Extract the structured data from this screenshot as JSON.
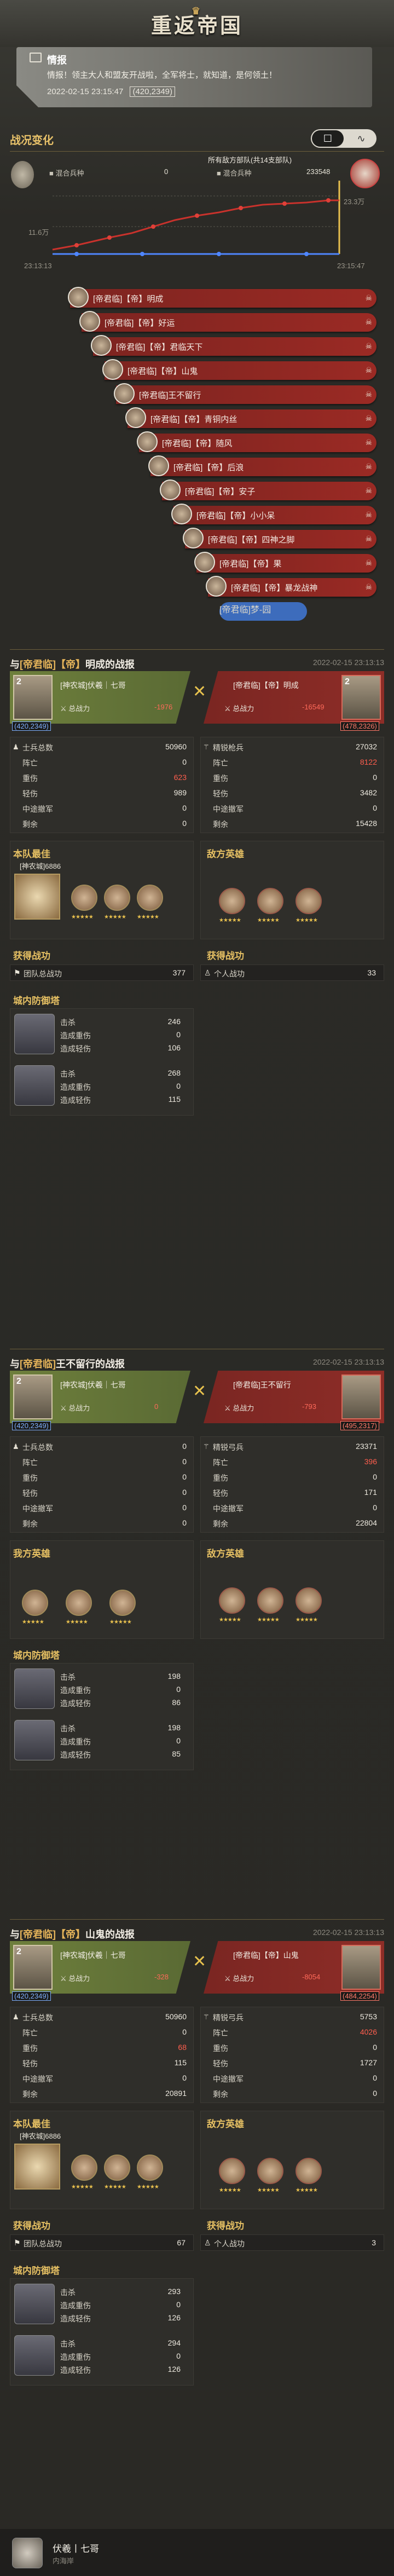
{
  "header": {
    "logo_text": "重返帝国"
  },
  "intel": {
    "title": "情报",
    "body": "情报！领主大人和盟友开战啦，全军将士，就知道，是何领土！",
    "date": "2022-02-15 23:15:47",
    "coords": "(420,2349)"
  },
  "trend": {
    "title": "战况变化",
    "toggle_on": "☐",
    "toggle_off": "∿",
    "left_label": "混合兵种",
    "left_value": "0",
    "right_caption": "所有敌方部队(共14支部队)",
    "right_label": "混合兵种",
    "right_value": "233548",
    "y_left": "11.6万",
    "y_right": "23.3万",
    "x_start": "23:13:13",
    "x_end": "23:15:47",
    "vs_right_icon": "king-icon"
  },
  "feed": [
    {
      "text": "[帝君临]【帝】明成"
    },
    {
      "text": "[帝君临]【帝】好运"
    },
    {
      "text": "[帝君临]【帝】君临天下"
    },
    {
      "text": "[帝君临]【帝】山鬼"
    },
    {
      "text": "[帝君临]王不留行"
    },
    {
      "text": "[帝君临]【帝】青铜内丝"
    },
    {
      "text": "[帝君临]【帝】随风"
    },
    {
      "text": "[帝君临]【帝】后浪"
    },
    {
      "text": "[帝君临]【帝】安子"
    },
    {
      "text": "[帝君临]【帝】小小呆"
    },
    {
      "text": "[帝君临]【帝】四神之脚"
    },
    {
      "text": "[帝君临]【帝】果"
    },
    {
      "text": "[帝君临]【帝】暴龙战神"
    },
    {
      "text": "[帝君临]梦-园"
    }
  ],
  "reports": [
    {
      "title_prefix": "与",
      "title_alli": "[帝君临]【帝】",
      "title_name": "明成",
      "title_suffix": "的战报",
      "date": "2022-02-15 23:13:13",
      "left": {
        "lv": "2",
        "name": "[神农城]伏羲｜七哥",
        "coords": "(420,2349)",
        "stat_label": "总战力",
        "stat_delta": "-1976"
      },
      "right": {
        "lv": "2",
        "name": "[帝君临]【帝】明成",
        "coords": "(478,2326)",
        "stat_label": "总战力",
        "stat_delta": "-16549"
      },
      "left_rows": [
        {
          "k": "士兵总数",
          "v": "50960",
          "red": false
        },
        {
          "k": "阵亡",
          "v": "0",
          "red": false
        },
        {
          "k": "重伤",
          "v": "623",
          "red": true
        },
        {
          "k": "轻伤",
          "v": "989",
          "red": false
        },
        {
          "k": "中途撤军",
          "v": "0",
          "red": false
        },
        {
          "k": "剩余",
          "v": "0",
          "red": false
        }
      ],
      "right_rows": [
        {
          "k": "精锐枪兵",
          "v": "27032",
          "red": false
        },
        {
          "k": "阵亡",
          "v": "8122",
          "red": true
        },
        {
          "k": "重伤",
          "v": "0",
          "red": false
        },
        {
          "k": "轻伤",
          "v": "3482",
          "red": false
        },
        {
          "k": "中途撤军",
          "v": "0",
          "red": false
        },
        {
          "k": "剩余",
          "v": "15428",
          "red": false
        }
      ],
      "mvp_title": "本队最佳",
      "mvp_name": "[神农城]",
      "mvp_value": "6886",
      "left_heroes_title": "",
      "right_heroes_title": "敌方英雄",
      "gain_title": "获得战功",
      "gain_left_label": "团队总战功",
      "gain_left_value": "377",
      "gain_right_label": "个人战功",
      "gain_right_value": "33",
      "tower_title": "城内防御塔",
      "towers": [
        {
          "kill": "246",
          "heavy": "0",
          "light": "106"
        },
        {
          "kill": "268",
          "heavy": "0",
          "light": "115"
        }
      ]
    },
    {
      "title_prefix": "与",
      "title_alli": "[帝君临]",
      "title_name": "王不留行",
      "title_suffix": "的战报",
      "date": "2022-02-15 23:13:13",
      "left": {
        "lv": "2",
        "name": "[神农城]伏羲｜七哥",
        "coords": "(420,2349)",
        "stat_label": "总战力",
        "stat_delta": "0"
      },
      "right": {
        "lv": "",
        "name": "[帝君临]王不留行",
        "coords": "(495,2317)",
        "stat_label": "总战力",
        "stat_delta": "-793"
      },
      "left_rows": [
        {
          "k": "士兵总数",
          "v": "0",
          "red": false
        },
        {
          "k": "阵亡",
          "v": "0",
          "red": false
        },
        {
          "k": "重伤",
          "v": "0",
          "red": false
        },
        {
          "k": "轻伤",
          "v": "0",
          "red": false
        },
        {
          "k": "中途撤军",
          "v": "0",
          "red": false
        },
        {
          "k": "剩余",
          "v": "0",
          "red": false
        }
      ],
      "right_rows": [
        {
          "k": "精锐弓兵",
          "v": "23371",
          "red": false
        },
        {
          "k": "阵亡",
          "v": "396",
          "red": true
        },
        {
          "k": "重伤",
          "v": "0",
          "red": false
        },
        {
          "k": "轻伤",
          "v": "171",
          "red": false
        },
        {
          "k": "中途撤军",
          "v": "0",
          "red": false
        },
        {
          "k": "剩余",
          "v": "22804",
          "red": false
        }
      ],
      "left_heroes_title": "我方英雄",
      "right_heroes_title": "敌方英雄",
      "tower_title": "城内防御塔",
      "towers": [
        {
          "kill": "198",
          "heavy": "0",
          "light": "86"
        },
        {
          "kill": "198",
          "heavy": "0",
          "light": "85"
        }
      ]
    },
    {
      "title_prefix": "与",
      "title_alli": "[帝君临]【帝】",
      "title_name": "山鬼",
      "title_suffix": "的战报",
      "date": "2022-02-15 23:13:13",
      "left": {
        "lv": "2",
        "name": "[神农城]伏羲｜七哥",
        "coords": "(420,2349)",
        "stat_label": "总战力",
        "stat_delta": "-328"
      },
      "right": {
        "lv": "",
        "name": "[帝君临]【帝】山鬼",
        "coords": "(484,2254)",
        "stat_label": "总战力",
        "stat_delta": "-8054"
      },
      "left_rows": [
        {
          "k": "士兵总数",
          "v": "50960",
          "red": false
        },
        {
          "k": "阵亡",
          "v": "0",
          "red": false
        },
        {
          "k": "重伤",
          "v": "68",
          "red": true
        },
        {
          "k": "轻伤",
          "v": "115",
          "red": false
        },
        {
          "k": "中途撤军",
          "v": "0",
          "red": false
        },
        {
          "k": "剩余",
          "v": "20891",
          "red": false
        }
      ],
      "right_rows": [
        {
          "k": "精锐弓兵",
          "v": "5753",
          "red": false
        },
        {
          "k": "阵亡",
          "v": "4026",
          "red": true
        },
        {
          "k": "重伤",
          "v": "0",
          "red": false
        },
        {
          "k": "轻伤",
          "v": "1727",
          "red": false
        },
        {
          "k": "中途撤军",
          "v": "0",
          "red": false
        },
        {
          "k": "剩余",
          "v": "0",
          "red": false
        }
      ],
      "mvp_title": "本队最佳",
      "mvp_name": "[神农城]",
      "mvp_value": "6886",
      "right_heroes_title": "敌方英雄",
      "gain_title": "获得战功",
      "gain_left_label": "团队总战功",
      "gain_left_value": "67",
      "gain_right_label": "个人战功",
      "gain_right_value": "3",
      "tower_title": "城内防御塔",
      "towers": [
        {
          "kill": "293",
          "heavy": "0",
          "light": "126"
        },
        {
          "kill": "294",
          "heavy": "0",
          "light": "126"
        }
      ]
    }
  ],
  "tower_labels": {
    "kill": "击杀",
    "heavy": "造成重伤",
    "light": "造成轻伤"
  },
  "footer": {
    "name": "伏羲丨七哥",
    "sub": "内海岸"
  }
}
